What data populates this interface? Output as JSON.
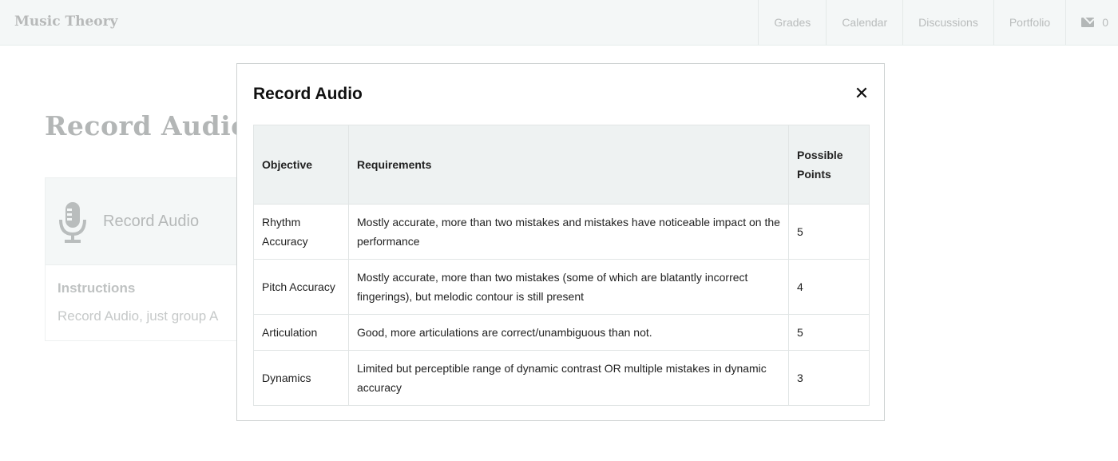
{
  "navbar": {
    "brand": "Music Theory",
    "links": [
      "Grades",
      "Calendar",
      "Discussions",
      "Portfolio"
    ],
    "messages_count": "0"
  },
  "page": {
    "title": "Record Audio",
    "card": {
      "heading": "Record Audio",
      "instructions_label": "Instructions",
      "instructions_text": "Record Audio, just group A"
    }
  },
  "modal": {
    "title": "Record Audio",
    "close_symbol": "✕",
    "table": {
      "headers": [
        "Objective",
        "Requirements",
        "Possible Points"
      ],
      "rows": [
        {
          "objective": "Rhythm Accuracy",
          "requirements": "Mostly accurate, more than two mistakes and mistakes have noticeable impact on the performance",
          "points": "5"
        },
        {
          "objective": "Pitch Accuracy",
          "requirements": "Mostly accurate, more than two mistakes (some of which are blatantly incorrect fingerings), but melodic contour is still present",
          "points": "4"
        },
        {
          "objective": "Articulation",
          "requirements": "Good, more articulations are correct/unambiguous than not.",
          "points": "5"
        },
        {
          "objective": "Dynamics",
          "requirements": "Limited but perceptible range of dynamic contrast OR multiple mistakes in dynamic accuracy",
          "points": "3"
        }
      ]
    }
  }
}
